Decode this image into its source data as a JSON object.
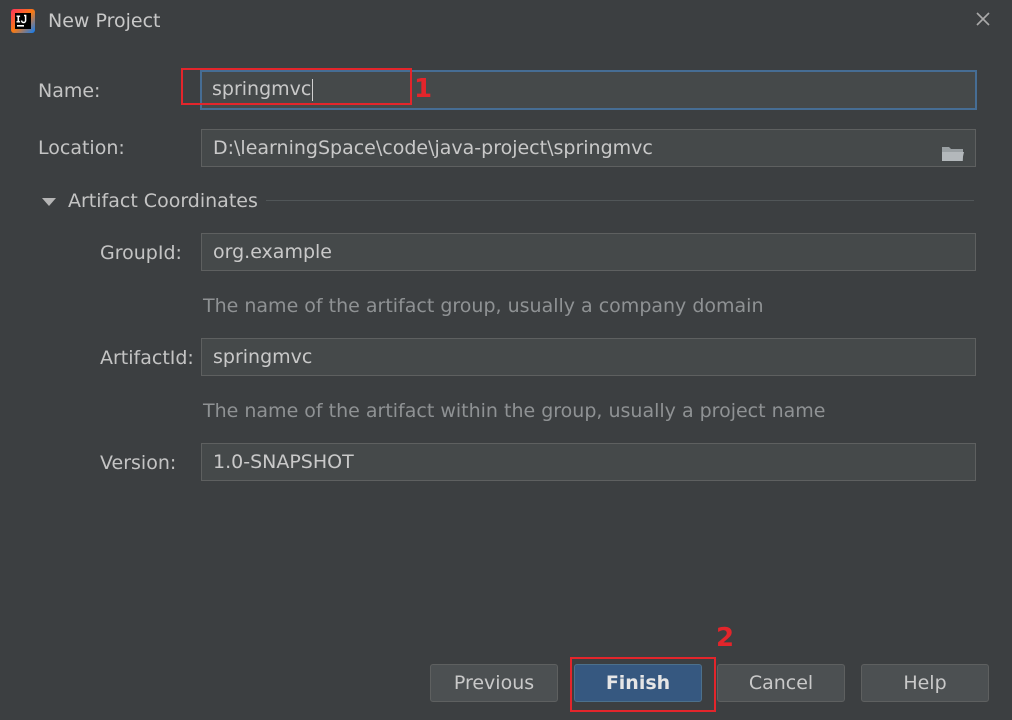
{
  "window": {
    "title": "New Project",
    "app_icon": "intellij-idea-icon",
    "close_icon": "close-icon"
  },
  "form": {
    "name_label": "Name:",
    "name_value": "springmvc",
    "location_label": "Location:",
    "location_value": "D:\\learningSpace\\code\\java-project\\springmvc",
    "browse_icon": "folder-icon"
  },
  "artifact": {
    "section_title": "Artifact Coordinates",
    "expand_icon": "triangle-down-icon",
    "group_label": "GroupId:",
    "group_value": "org.example",
    "group_hint": "The name of the artifact group, usually a company domain",
    "artifact_label": "ArtifactId:",
    "artifact_value": "springmvc",
    "artifact_hint": "The name of the artifact within the group, usually a project name",
    "version_label": "Version:",
    "version_value": "1.0-SNAPSHOT"
  },
  "annotations": {
    "step1": "1",
    "step2": "2",
    "color": "#e3252b"
  },
  "buttons": {
    "previous": "Previous",
    "finish": "Finish",
    "cancel": "Cancel",
    "help": "Help"
  },
  "colors": {
    "background": "#3c3f41",
    "field_bg": "#45494a",
    "focus_border": "#466d94",
    "primary_button": "#365880"
  }
}
